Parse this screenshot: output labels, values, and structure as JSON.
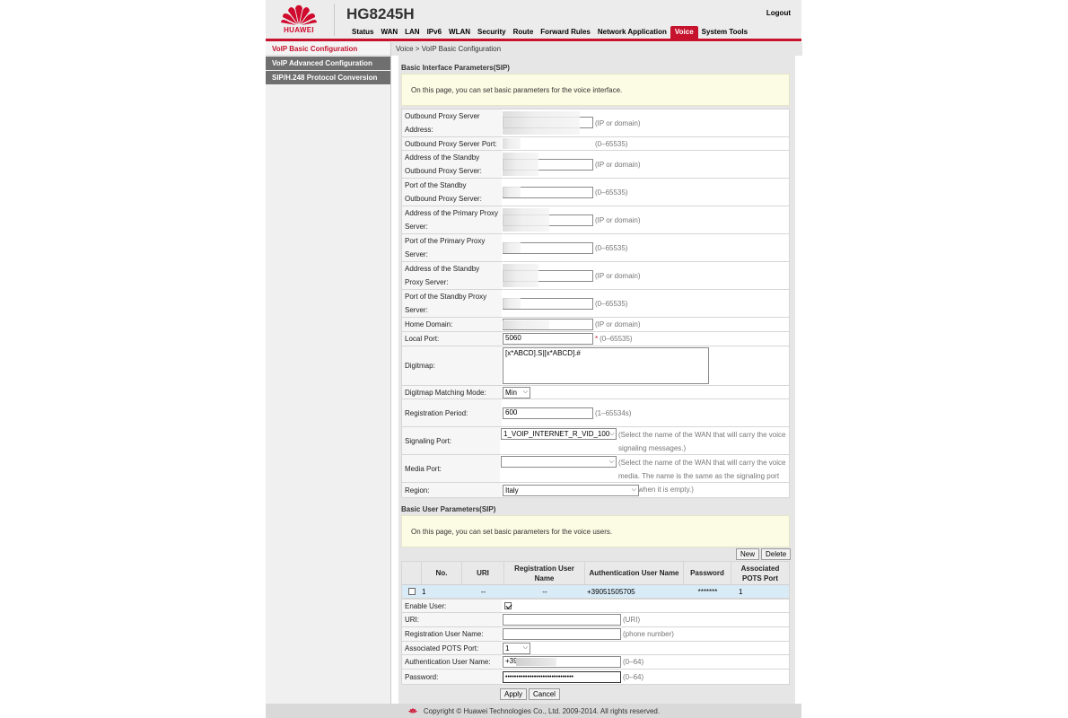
{
  "header": {
    "brand": "HUAWEI",
    "model": "HG8245H",
    "logout": "Logout",
    "nav": [
      "Status",
      "WAN",
      "LAN",
      "IPv6",
      "WLAN",
      "Security",
      "Route",
      "Forward Rules",
      "Network Application",
      "Voice",
      "System Tools"
    ],
    "active_nav": "Voice"
  },
  "sidebar": {
    "items": [
      {
        "label": "VoIP Basic Configuration",
        "active": true
      },
      {
        "label": "VoIP Advanced Configuration",
        "active": false
      },
      {
        "label": "SIP/H.248 Protocol Conversion",
        "active": false
      }
    ]
  },
  "breadcrumb": "Voice > VoIP Basic Configuration",
  "interface": {
    "title": "Basic Interface Parameters(SIP)",
    "notice": "On this page, you can set basic parameters for the voice interface.",
    "outbound_proxy_address": {
      "label": "Outbound Proxy Server Address:",
      "hint": "(IP or domain)"
    },
    "outbound_proxy_port": {
      "label": "Outbound Proxy Server Port:",
      "hint": "(0–65535)"
    },
    "standby_outbound_address": {
      "label": "Address of the Standby Outbound Proxy Server:",
      "hint": "(IP or domain)"
    },
    "standby_outbound_port": {
      "label": "Port of the Standby Outbound Proxy Server:",
      "hint": "(0–65535)"
    },
    "primary_proxy_address": {
      "label": "Address of the Primary Proxy Server:",
      "hint": "(IP or domain)"
    },
    "primary_proxy_port": {
      "label": "Port of the Primary Proxy Server:",
      "hint": "(0–65535)"
    },
    "standby_proxy_address": {
      "label": "Address of the Standby Proxy Server:",
      "hint": "(IP or domain)"
    },
    "standby_proxy_port": {
      "label": "Port of the Standby Proxy Server:",
      "hint": "(0–65535)"
    },
    "home_domain": {
      "label": "Home Domain:",
      "hint": "(IP or domain)"
    },
    "local_port": {
      "label": "Local Port:",
      "value": "5060",
      "required": "*",
      "hint": "(0–65535)"
    },
    "digitmap": {
      "label": "Digitmap:",
      "value": "[x*ABCD].S|[x*ABCD].#"
    },
    "digitmap_mode": {
      "label": "Digitmap Matching Mode:",
      "value": "Min"
    },
    "registration_period": {
      "label": "Registration Period:",
      "value": "600",
      "hint": "(1–65534s)"
    },
    "signaling_port": {
      "label": "Signaling Port:",
      "value": "1_VOIP_INTERNET_R_VID_100",
      "hint": "(Select the name of the WAN that will carry the voice signaling messages.)"
    },
    "media_port": {
      "label": "Media Port:",
      "value": "",
      "hint": "(Select the name of the WAN that will carry the voice media. The name is the same as the signaling port name when it is empty.)"
    },
    "region": {
      "label": "Region:",
      "value": "Italy"
    }
  },
  "users": {
    "title": "Basic User Parameters(SIP)",
    "notice": "On this page, you can set basic parameters for the voice users.",
    "new_label": "New",
    "delete_label": "Delete",
    "columns": [
      "No.",
      "URI",
      "Registration User Name",
      "Authentication User Name",
      "Password",
      "Associated POTS Port"
    ],
    "rows": [
      {
        "no": "1",
        "uri": "--",
        "reg_user": "--",
        "auth_user": "+39051505705",
        "password": "*******",
        "pots": "1"
      }
    ],
    "form": {
      "enable_user": {
        "label": "Enable User:"
      },
      "uri": {
        "label": "URI:",
        "value": "",
        "hint": "(URI)"
      },
      "reg_user": {
        "label": "Registration User Name:",
        "value": "",
        "hint": "(phone number)"
      },
      "pots_port": {
        "label": "Associated POTS Port:",
        "value": "1"
      },
      "auth_user": {
        "label": "Authentication User Name:",
        "value": "+39",
        "hint": "(0–64)"
      },
      "password": {
        "label": "Password:",
        "value": "•••••••••••••••••••••••••••••••",
        "hint": "(0–64)"
      }
    },
    "apply_label": "Apply",
    "cancel_label": "Cancel"
  },
  "footer": {
    "copyright": "Copyright © Huawei Technologies Co., Ltd. 2009-2014. All rights reserved."
  },
  "colors": {
    "brand_red": "#c6122d",
    "notice_bg": "#fcfbe4",
    "row_highlight": "#d8ebf6"
  }
}
